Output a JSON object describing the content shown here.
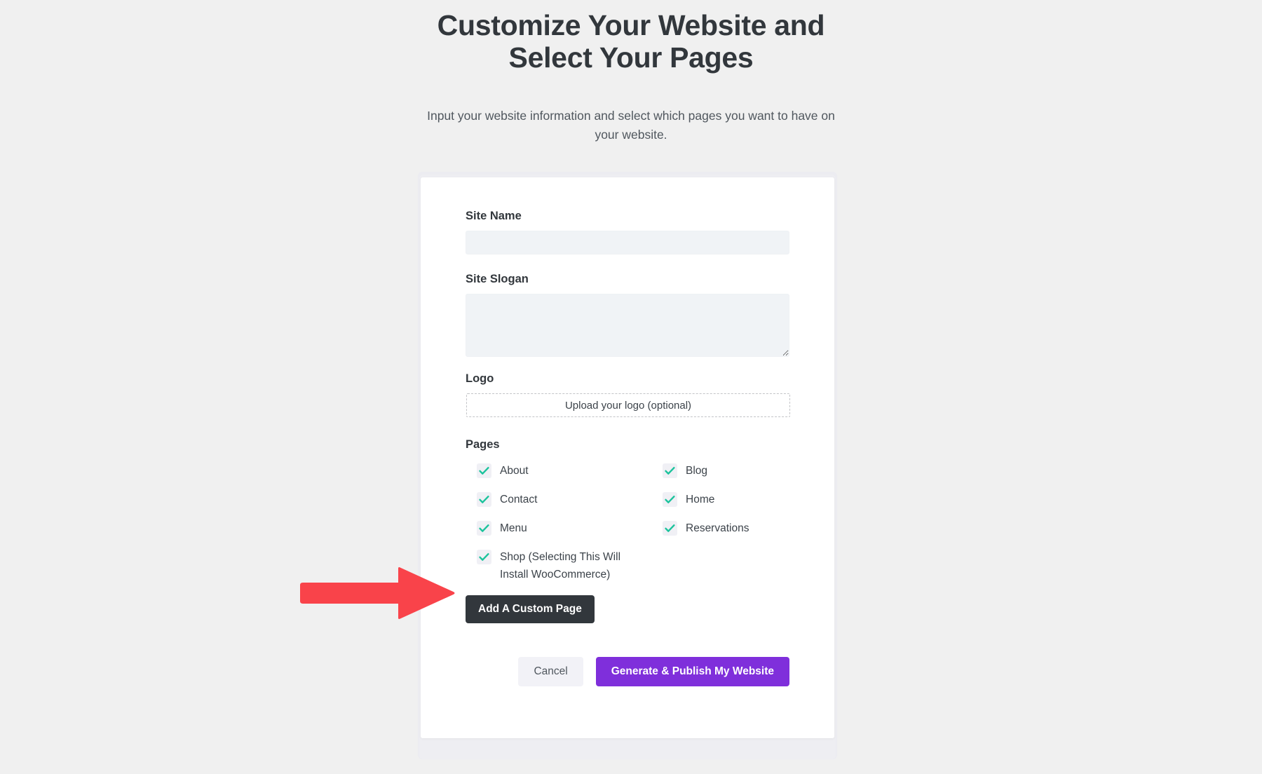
{
  "header": {
    "title": "Customize Your Website and Select Your Pages",
    "subtitle": "Input your website information and select which pages you want to have on your website."
  },
  "colors": {
    "background": "#f0f0f0",
    "card": "#ffffff",
    "input_fill": "#f0f3f6",
    "checkbox_fill": "#f0f0f5",
    "check_green": "#1bc39c",
    "primary_purple": "#7f2fdb",
    "dark_button": "#32373c",
    "cancel_button": "#f2f2f7",
    "annotation_red": "#f9434a",
    "title_text": "#32373c",
    "body_text": "#3c434a"
  },
  "form": {
    "site_name": {
      "label": "Site Name",
      "value": "",
      "placeholder": ""
    },
    "site_slogan": {
      "label": "Site Slogan",
      "value": "",
      "placeholder": ""
    },
    "logo": {
      "label": "Logo",
      "upload_text": "Upload your logo (optional)"
    },
    "pages": {
      "label": "Pages",
      "items": [
        {
          "label": "About",
          "checked": true
        },
        {
          "label": "Blog",
          "checked": true
        },
        {
          "label": "Contact",
          "checked": true
        },
        {
          "label": "Home",
          "checked": true
        },
        {
          "label": "Menu",
          "checked": true
        },
        {
          "label": "Reservations",
          "checked": true
        },
        {
          "label": "Shop (Selecting This Will Install WooCommerce)",
          "checked": true
        }
      ]
    },
    "add_custom_page_label": "Add A Custom Page"
  },
  "footer": {
    "cancel_label": "Cancel",
    "submit_label": "Generate & Publish My Website"
  },
  "annotation": {
    "type": "arrow",
    "direction": "right",
    "points_at": "Shop (Selecting This Will Install WooCommerce)"
  }
}
